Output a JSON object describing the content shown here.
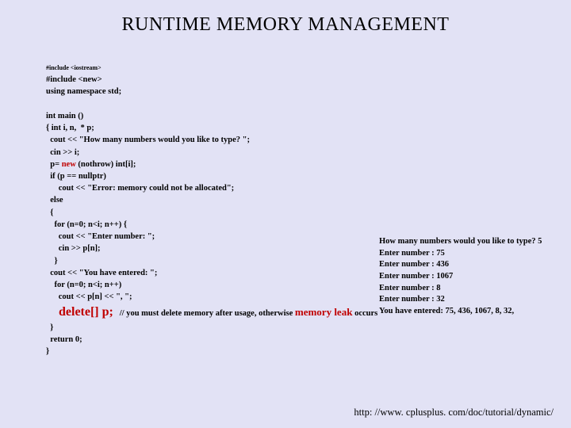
{
  "title": "RUNTIME MEMORY MANAGEMENT",
  "code": {
    "inc1": "#include <iostream>",
    "inc2": "#include <new>",
    "using": "using namespace std;",
    "main": "int main ()",
    "decl": "{ int i, n,  * p;",
    "cout1": "  cout << \"How many numbers would you like to type? \";",
    "cin1": "  cin >> i;",
    "palloc_pre": "  p= ",
    "palloc_new": "new",
    "palloc_post": " (nothrow) int[i];",
    "ifnull": "  if (p == nullptr)",
    "err": "      cout << \"Error: memory could not be allocated\";",
    "else": "  else",
    "ob": "  {",
    "for1": "    for (n=0; n<i; n++) {",
    "cout2": "      cout << \"Enter number: \";",
    "cin2": "      cin >> p[n];",
    "cb1": "    }",
    "cout3": "  cout << \"You have entered: \";",
    "for2": "    for (n=0; n<i; n++)",
    "cout4": "      cout << p[n] << \", \";",
    "delete": "    delete[] p;",
    "comment_pre": "   // you must delete memory after usage, otherwise ",
    "comment_leak": "memory leak",
    "comment_post": " occurs",
    "cb2": "  }",
    "ret": "  return 0;",
    "cb3": "}"
  },
  "output": {
    "l1": "How many numbers would you like to type? 5",
    "l2": "Enter number : 75",
    "l3": "Enter number : 436",
    "l4": "Enter number : 1067",
    "l5": "Enter number : 8",
    "l6": "Enter number : 32",
    "l7": "You have entered: 75, 436, 1067, 8, 32,"
  },
  "url": "http: //www. cplusplus. com/doc/tutorial/dynamic/"
}
